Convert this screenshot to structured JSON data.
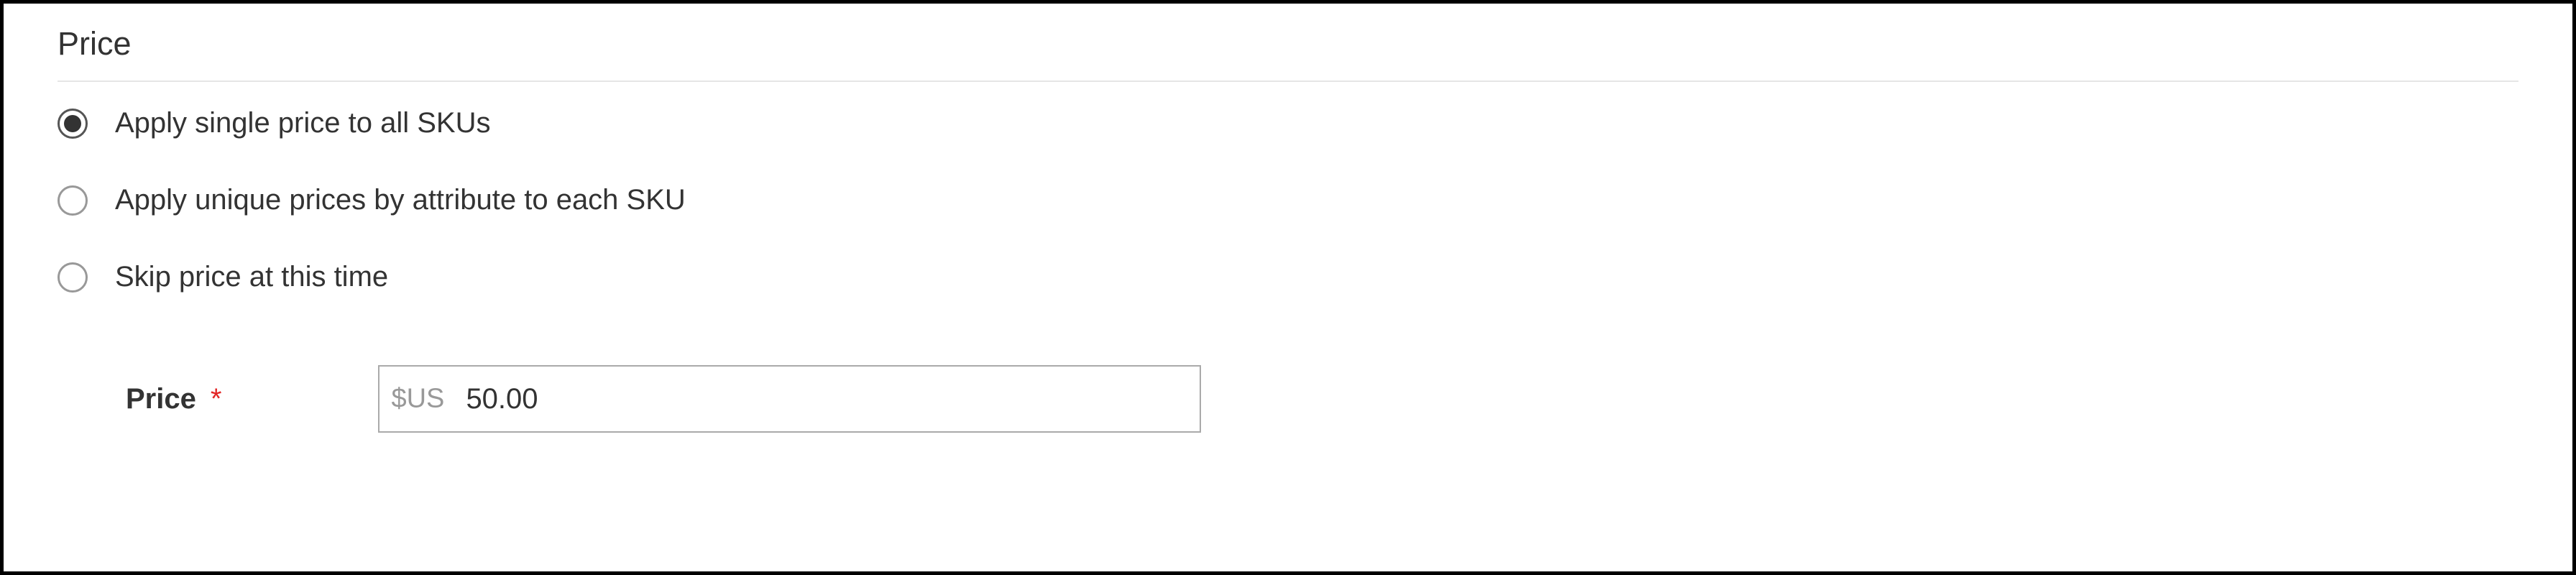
{
  "section": {
    "title": "Price"
  },
  "radios": {
    "items": [
      {
        "label": "Apply single price to all SKUs",
        "selected": true
      },
      {
        "label": "Apply unique prices by attribute to each SKU",
        "selected": false
      },
      {
        "label": "Skip price at this time",
        "selected": false
      }
    ]
  },
  "field": {
    "label": "Price",
    "required_marker": "*",
    "currency_prefix": "$US",
    "value": "50.00"
  }
}
